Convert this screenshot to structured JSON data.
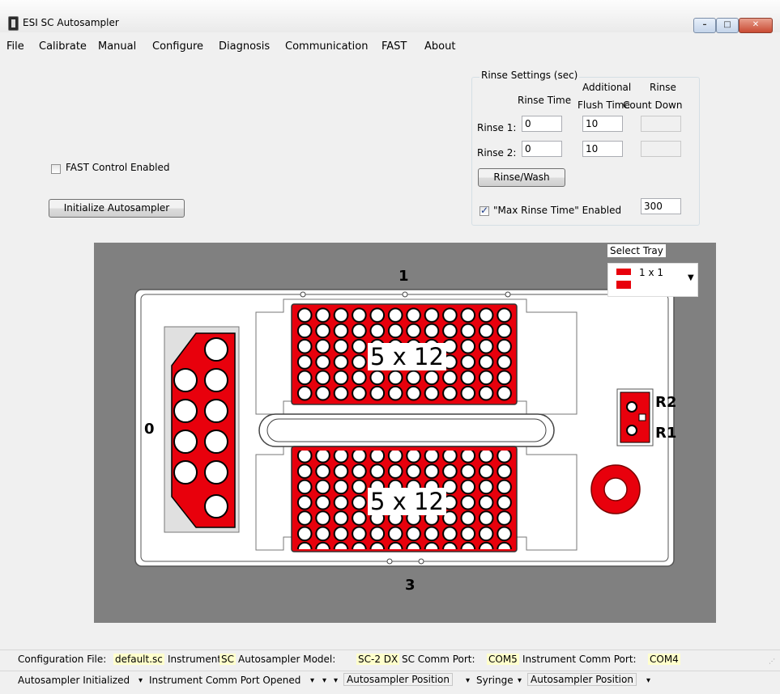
{
  "window": {
    "title": "ESI SC Autosampler",
    "minimize": "–",
    "maximize": "□",
    "close": "✕"
  },
  "menu": [
    "File",
    "Calibrate",
    "Manual",
    "Configure",
    "Diagnosis",
    "Communication",
    "FAST",
    "About"
  ],
  "fast_control": {
    "label": "FAST Control Enabled",
    "checked": false
  },
  "initialize_button": "Initialize Autosampler",
  "rinse": {
    "group_title": "Rinse Settings (sec)",
    "col_rinse_time": "Rinse Time",
    "col_additional_1": "Additional",
    "col_additional_2": "Flush Time",
    "col_countdown_1": "Rinse",
    "col_countdown_2": "Count Down",
    "rinse1_label": "Rinse 1:",
    "rinse1_time": "0",
    "rinse1_flush": "10",
    "rinse1_countdown": "",
    "rinse2_label": "Rinse 2:",
    "rinse2_time": "0",
    "rinse2_flush": "10",
    "rinse2_countdown": "",
    "rinsewash_button": "Rinse/Wash",
    "max_rinse_label": "\"Max Rinse Time\" Enabled",
    "max_rinse_checked": true,
    "max_rinse_value": "300"
  },
  "tray": {
    "select_tray_label": "Select Tray",
    "selected": "1 x 1",
    "label_top": "1",
    "label_left": "0",
    "label_bottom": "3",
    "rack_top_label": "5 x 12",
    "rack_bottom_label": "5 x 12",
    "rinse_r2": "R2",
    "rinse_r1": "R1",
    "accent_color": "#e8000c"
  },
  "status1": {
    "config_label": "Configuration File:",
    "config_value": "default.sc",
    "instrument_label": "Instrument:",
    "instrument_value": "SC",
    "model_label": "Autosampler Model:",
    "model_value": "SC-2 DX",
    "sc_port_label": "SC Comm Port:",
    "sc_port_value": "COM5",
    "inst_port_label": "Instrument Comm Port:",
    "inst_port_value": "COM4"
  },
  "status2": {
    "item1": "Autosampler Initialized",
    "item2": "Instrument Comm Port Opened",
    "item3": "Autosampler Position",
    "item4": "Syringe",
    "item5": "Autosampler Position",
    "dropdown": "▾"
  }
}
